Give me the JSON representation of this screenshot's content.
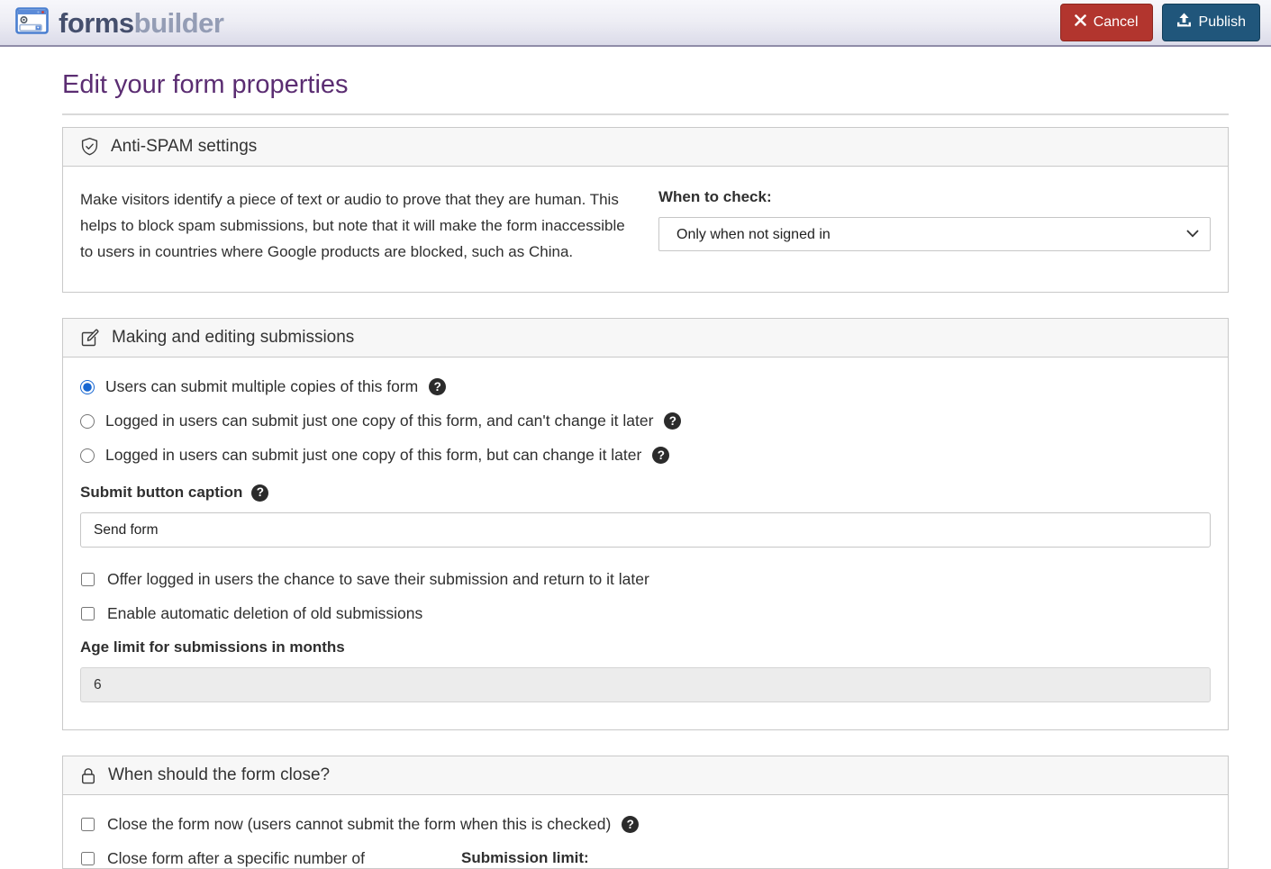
{
  "header": {
    "brand_bold": "forms",
    "brand_light": "builder",
    "cancel_label": "Cancel",
    "publish_label": "Publish"
  },
  "page": {
    "title": "Edit your form properties"
  },
  "antispam": {
    "title": "Anti-SPAM settings",
    "description": "Make visitors identify a piece of text or audio to prove that they are human. This helps to block spam submissions, but note that it will make the form inaccessible to users in countries where Google products are blocked, such as China.",
    "when_to_check_label": "When to check:",
    "when_to_check_value": "Only when not signed in"
  },
  "submissions": {
    "title": "Making and editing submissions",
    "radios": [
      {
        "label": "Users can submit multiple copies of this form",
        "selected": true
      },
      {
        "label": "Logged in users can submit just one copy of this form, and can't change it later",
        "selected": false
      },
      {
        "label": "Logged in users can submit just one copy of this form, but can change it later",
        "selected": false
      }
    ],
    "submit_caption_label": "Submit button caption",
    "submit_caption_value": "Send form",
    "checkboxes": [
      "Offer logged in users the chance to save their submission and return to it later",
      "Enable automatic deletion of old submissions"
    ],
    "age_limit_label": "Age limit for submissions in months",
    "age_limit_value": "6"
  },
  "closing": {
    "title": "When should the form close?",
    "close_now_label": "Close the form now (users cannot submit the form when this is checked)",
    "close_after_label": "Close form after a specific number of",
    "submission_limit_label": "Submission limit:"
  },
  "icons": {
    "logo": "form-window-icon",
    "cancel": "x-icon",
    "publish": "upload-icon",
    "antispam": "shield-check-icon",
    "submissions": "edit-pencil-icon",
    "closing": "lock-icon",
    "help": "question-circle-icon",
    "select": "chevron-down-icon"
  },
  "colors": {
    "cancel_red": "#b2352e",
    "publish_blue": "#20567b",
    "title_purple": "#5b2d72",
    "radio_blue": "#1767d2",
    "topbar_border": "#8f8ca8",
    "section_border": "#c9c9c9",
    "section_header_bg": "#f7f7f7"
  }
}
